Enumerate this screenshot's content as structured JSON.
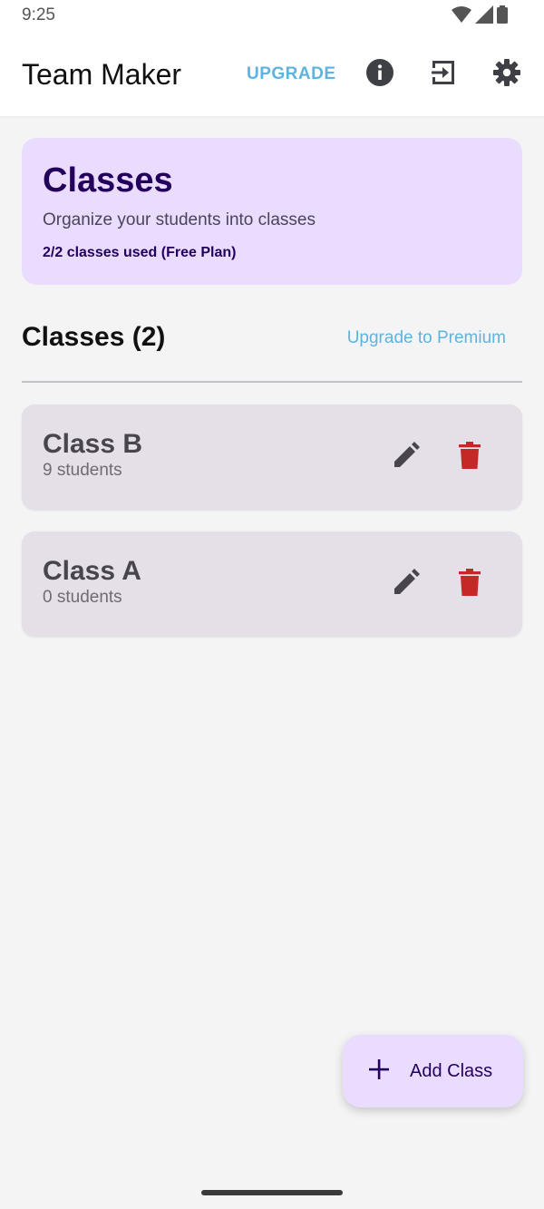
{
  "status_bar": {
    "time": "9:25",
    "icons": [
      "wifi-icon",
      "signal-icon",
      "battery-icon"
    ]
  },
  "app_bar": {
    "title": "Team Maker",
    "upgrade_label": "UPGRADE",
    "actions": [
      "info-icon",
      "exit-icon",
      "settings-icon"
    ]
  },
  "hero": {
    "title": "Classes",
    "subtitle": "Organize your students into classes",
    "usage": "2/2 classes used (Free Plan)"
  },
  "section": {
    "title": "Classes (2)",
    "premium_link": "Upgrade to Premium"
  },
  "classes": [
    {
      "name": "Class B",
      "count": "9 students"
    },
    {
      "name": "Class A",
      "count": "0 students"
    }
  ],
  "fab": {
    "label": "Add Class",
    "icon": "plus-icon"
  },
  "colors": {
    "accent_link": "#5fb3e0",
    "hero_bg": "#eadcff",
    "hero_text": "#23005c",
    "card_bg": "#e5dfe8",
    "delete": "#c62828",
    "edit": "#49454f"
  }
}
